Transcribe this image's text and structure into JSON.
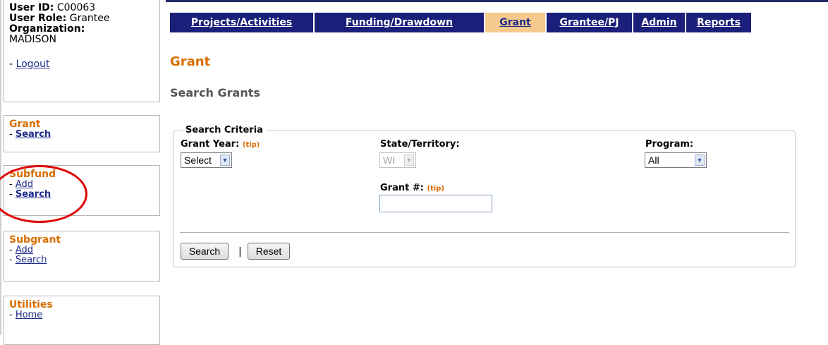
{
  "user": {
    "id_label": "User ID:",
    "id_value": "C00063",
    "role_label": "User Role:",
    "role_value": "Grantee",
    "org_label": "Organization:",
    "org_value": "MADISON",
    "logout_prefix": "- ",
    "logout": "Logout"
  },
  "sidebar": {
    "grant": {
      "header": "Grant",
      "items": [
        {
          "prefix": "- ",
          "label": "Search"
        }
      ]
    },
    "subfund": {
      "header": "Subfund",
      "items": [
        {
          "prefix": "- ",
          "label": "Add"
        },
        {
          "prefix": "- ",
          "label": "Search"
        }
      ]
    },
    "subgrant": {
      "header": "Subgrant",
      "items": [
        {
          "prefix": "- ",
          "label": "Add"
        },
        {
          "prefix": "- ",
          "label": "Search"
        }
      ]
    },
    "utilities": {
      "header": "Utilities",
      "items": [
        {
          "prefix": "- ",
          "label": "Home"
        }
      ]
    }
  },
  "nav": {
    "tabs": [
      "Projects/Activities",
      "Funding/Drawdown",
      "Grant",
      "Grantee/PJ",
      "Admin",
      "Reports"
    ],
    "active": "Grant"
  },
  "page": {
    "title": "Grant",
    "subtitle": "Search Grants"
  },
  "search": {
    "legend": "Search Criteria",
    "grant_year_label": "Grant Year:",
    "grant_year_tip": "(tip)",
    "grant_year_value": "Select",
    "state_label": "State/Territory:",
    "state_value": "WI",
    "program_label": "Program:",
    "program_value": "All",
    "grant_no_label": "Grant #:",
    "grant_no_tip": "(tip)",
    "grant_no_value": "",
    "search_button": "Search",
    "separator": "|",
    "reset_button": "Reset"
  },
  "colors": {
    "nav_bg": "#1a1f7a",
    "active_tab": "#f6c98e",
    "accent": "#d96e00",
    "link": "#1c2a8a",
    "annotation": "#e00000"
  }
}
